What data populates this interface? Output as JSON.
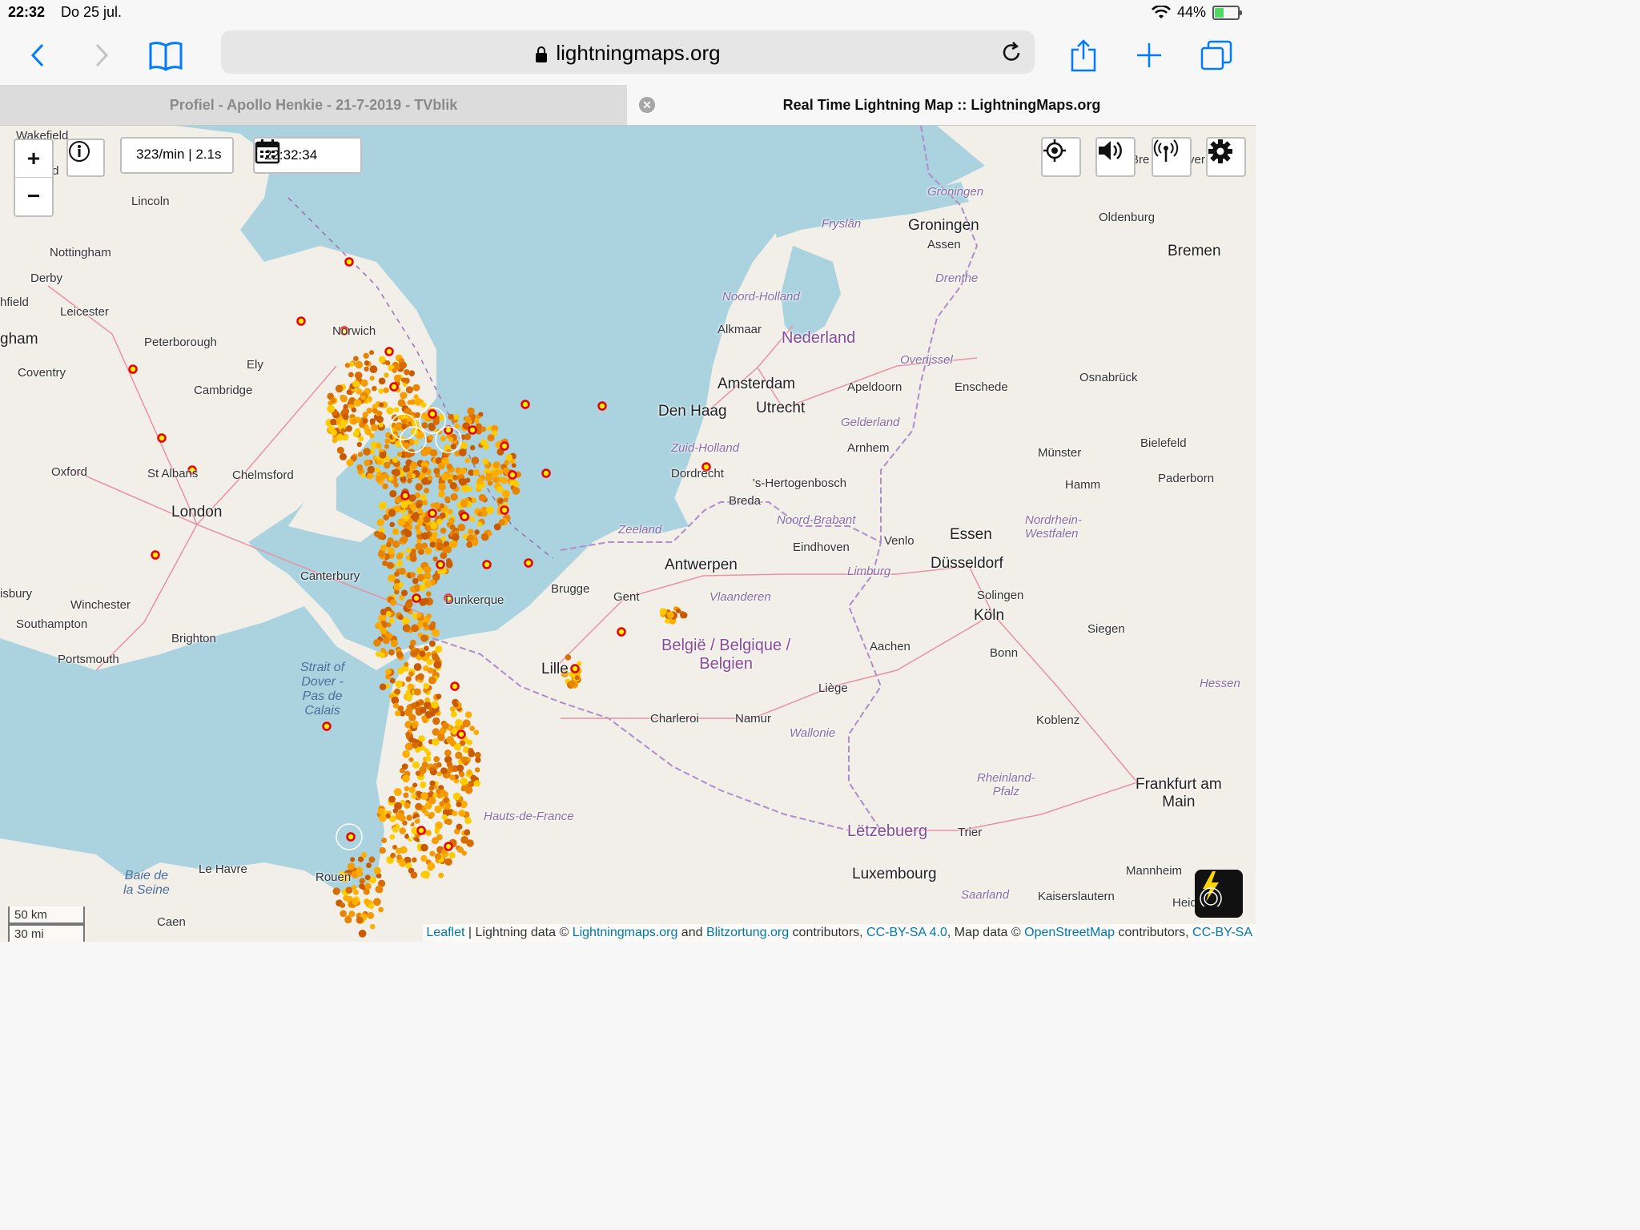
{
  "status": {
    "time": "22:32",
    "date": "Do 25 jul.",
    "battery": "44%",
    "battery_level": 0.44
  },
  "browser": {
    "url": "lightningmaps.org"
  },
  "tabs": [
    {
      "title": "Profiel - Apollo Henkie - 21-7-2019 - TVblik",
      "active": false
    },
    {
      "title": "Real Time Lightning Map :: LightningMaps.org",
      "active": true
    }
  ],
  "map": {
    "zoom_in": "+",
    "zoom_out": "−",
    "rate": "323/min | 2.1s",
    "clock": "22:32:34",
    "scale_km": "50 km",
    "scale_mi": "30 mi",
    "attribution": {
      "leaflet": "Leaflet",
      "sep1": " | Lightning data © ",
      "lm": "Lightningmaps.org",
      "and": " and ",
      "blitz": "Blitzortung.org",
      "contrib1": " contributors, ",
      "cc1": "CC-BY-SA 4.0",
      "mapdata": ", Map data © ",
      "osm": "OpenStreetMap",
      "contrib2": " contributors, ",
      "cc2": "CC-BY-SA"
    },
    "labels": {
      "wakefield": "Wakefield",
      "lincoln": "Lincoln",
      "nottingham": "Nottingham",
      "derby": "Derby",
      "hfield": "hfield",
      "leicester": "Leicester",
      "gham": "gham",
      "coventry": "Coventry",
      "peterborough": "Peterborough",
      "norwich": "Norwich",
      "ely": "Ely",
      "cambridge": "Cambridge",
      "oxford": "Oxford",
      "stalbans": "St Albans",
      "chelmsford": "Chelmsford",
      "london": "London",
      "isbury": "isbury",
      "winchester": "Winchester",
      "southampton": "Southampton",
      "brighton": "Brighton",
      "portsmouth": "Portsmouth",
      "canterbury": "Canterbury",
      "dunkerque": "Dunkerque",
      "brugge": "Brugge",
      "gent": "Gent",
      "antwerpen": "Antwerpen",
      "lille": "Lille",
      "strait": "Strait of\nDover -\nPas de\nCalais",
      "baie": "Baie de\nla Seine",
      "lehavre": "Le Havre",
      "rouen": "Rouen",
      "caen": "Caen",
      "hauts": "Hauts-de-France",
      "groningenp": "Groningen",
      "groningen": "Groningen",
      "assen": "Assen",
      "fryslan": "Fryslân",
      "drenthe": "Drenthe",
      "oldenburg": "Oldenburg",
      "bremen": "Bremen",
      "noordholland": "Noord-Holland",
      "alkmaar": "Alkmaar",
      "nederland": "Nederland",
      "overijssel": "Overijssel",
      "amsterdam": "Amsterdam",
      "apeldoorn": "Apeldoorn",
      "enschede": "Enschede",
      "osnabruck": "Osnabrück",
      "denhaag": "Den Haag",
      "utrecht": "Utrecht",
      "gelderland": "Gelderland",
      "arnhem": "Arnhem",
      "zuidholland": "Zuid-Holland",
      "dordrecht": "Dordrecht",
      "shertogenbosch": "'s-Hertogenbosch",
      "bielefeld": "Bielefeld",
      "munster": "Münster",
      "hamm": "Hamm",
      "paderborn": "Paderborn",
      "breda": "Breda",
      "zeeland": "Zeeland",
      "noordbrabant": "Noord-Brabant",
      "eindhoven": "Eindhoven",
      "venlo": "Venlo",
      "essen": "Essen",
      "nrw": "Nordrhein-\nWestfalen",
      "limburg": "Limburg",
      "dusseldorf": "Düsseldorf",
      "vlaanderen": "Vlaanderen",
      "solingen": "Solingen",
      "koln": "Köln",
      "belgie": "België / Belgique /\nBelgien",
      "aachen": "Aachen",
      "siegen": "Siegen",
      "bonn": "Bonn",
      "hessen": "Hessen",
      "liege": "Liège",
      "charleroi": "Charleroi",
      "namur": "Namur",
      "wallonie": "Wallonie",
      "koblenz": "Koblenz",
      "rheinland": "Rheinland-\nPfalz",
      "frankfurt": "Frankfurt am\nMain",
      "letzebuerg": "Lëtzebuerg",
      "trier": "Trier",
      "luxembourg": "Luxembourg",
      "mannheim": "Mannheim",
      "saarland": "Saarland",
      "kaiserslautern": "Kaiserslautern",
      "heidelb": "Heidelb",
      "bre": "Bre",
      "ver": "ver",
      "field": "field"
    }
  },
  "colors": {
    "sea": "#aad3df",
    "land": "#f2efe9",
    "accent": "#007aff",
    "strike_new": "#ffff00",
    "strike_old": "#d45500"
  }
}
